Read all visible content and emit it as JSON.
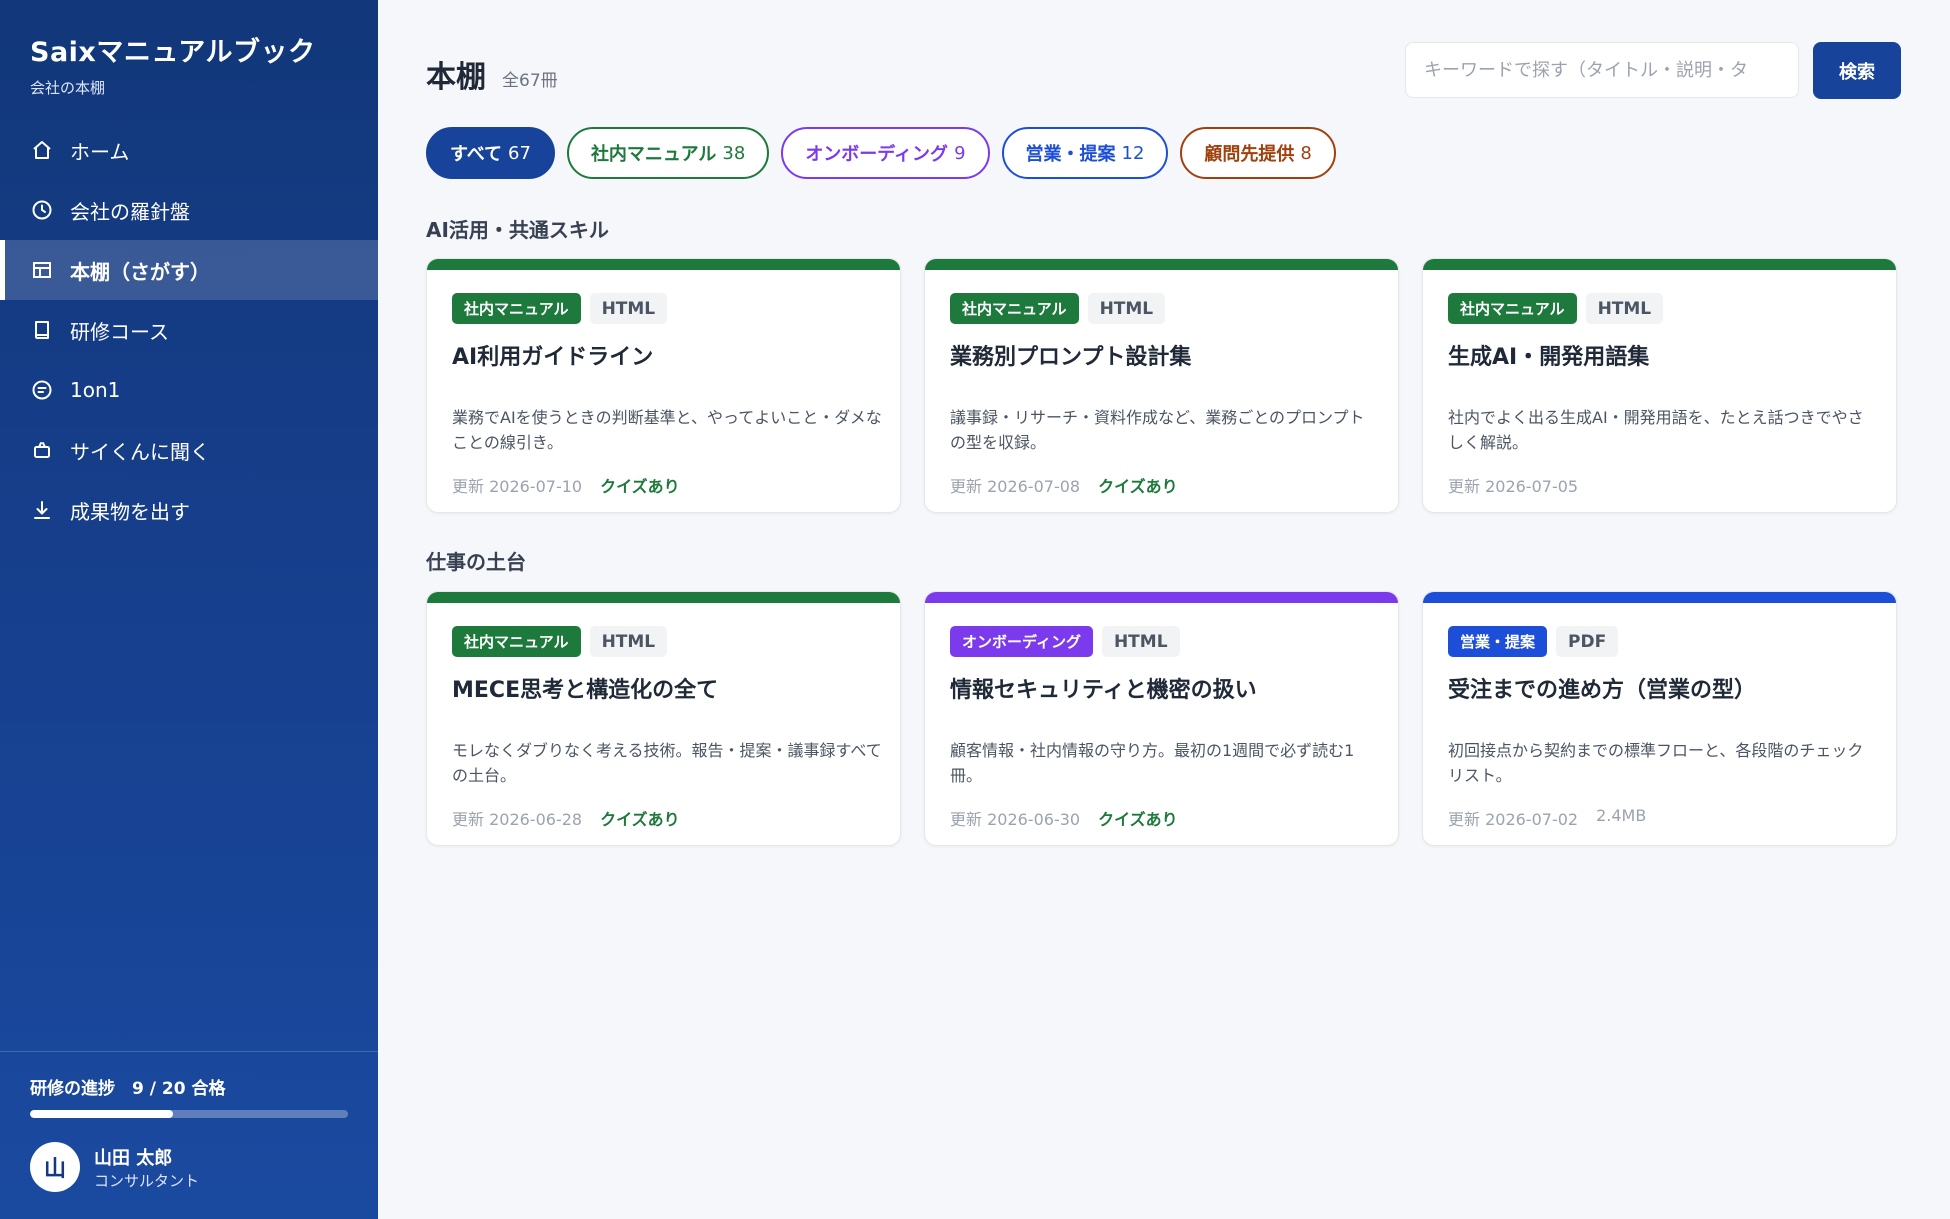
{
  "brand": {
    "title": "Saixマニュアルブック",
    "subtitle": "会社の本棚"
  },
  "nav": [
    {
      "label": "ホーム",
      "icon": "home-icon",
      "active": false
    },
    {
      "label": "会社の羅針盤",
      "icon": "compass-icon",
      "active": false
    },
    {
      "label": "本棚（さがす）",
      "icon": "bookshelf-icon",
      "active": true
    },
    {
      "label": "研修コース",
      "icon": "book-icon",
      "active": false
    },
    {
      "label": "1on1",
      "icon": "chat-icon",
      "active": false
    },
    {
      "label": "サイくんに聞く",
      "icon": "bot-icon",
      "active": false
    },
    {
      "label": "成果物を出す",
      "icon": "download-icon",
      "active": false
    }
  ],
  "progress": {
    "label": "研修の進捗　9 / 20 合格",
    "passed": 9,
    "total": 20
  },
  "user": {
    "initial": "山",
    "name": "山田 太郎",
    "role": "コンサルタント"
  },
  "header": {
    "title": "本棚",
    "count": "全67冊",
    "search_placeholder": "キーワードで探す（タイトル・説明・タ",
    "search_button": "検索"
  },
  "filters": [
    {
      "label": "すべて",
      "count": "67",
      "style": "all"
    },
    {
      "label": "社内マニュアル",
      "count": "38",
      "style": "green"
    },
    {
      "label": "オンボーディング",
      "count": "9",
      "style": "purple"
    },
    {
      "label": "営業・提案",
      "count": "12",
      "style": "blue"
    },
    {
      "label": "顧問先提供",
      "count": "8",
      "style": "brown"
    }
  ],
  "colors": {
    "green": "#1e7a3c",
    "purple": "#7c3aed",
    "blue": "#1d4ed8",
    "brown": "#a0410d"
  },
  "sections": [
    {
      "title": "AI活用・共通スキル",
      "cards": [
        {
          "category": "社内マニュアル",
          "color": "green",
          "format": "HTML",
          "title": "AI利用ガイドライン",
          "desc": "業務でAIを使うときの判断基準と、やってよいこと・ダメなことの線引き。",
          "updated": "更新 2026-07-10",
          "extra": "クイズあり",
          "extra_type": "quiz"
        },
        {
          "category": "社内マニュアル",
          "color": "green",
          "format": "HTML",
          "title": "業務別プロンプト設計集",
          "desc": "議事録・リサーチ・資料作成など、業務ごとのプロンプトの型を収録。",
          "updated": "更新 2026-07-08",
          "extra": "クイズあり",
          "extra_type": "quiz"
        },
        {
          "category": "社内マニュアル",
          "color": "green",
          "format": "HTML",
          "title": "生成AI・開発用語集",
          "desc": "社内でよく出る生成AI・開発用語を、たとえ話つきでやさしく解説。",
          "updated": "更新 2026-07-05",
          "extra": "",
          "extra_type": "none"
        }
      ]
    },
    {
      "title": "仕事の土台",
      "cards": [
        {
          "category": "社内マニュアル",
          "color": "green",
          "format": "HTML",
          "title": "MECE思考と構造化の全て",
          "desc": "モレなくダブりなく考える技術。報告・提案・議事録すべての土台。",
          "updated": "更新 2026-06-28",
          "extra": "クイズあり",
          "extra_type": "quiz"
        },
        {
          "category": "オンボーディング",
          "color": "purple",
          "format": "HTML",
          "title": "情報セキュリティと機密の扱い",
          "desc": "顧客情報・社内情報の守り方。最初の1週間で必ず読む1冊。",
          "updated": "更新 2026-06-30",
          "extra": "クイズあり",
          "extra_type": "quiz"
        },
        {
          "category": "営業・提案",
          "color": "blue",
          "format": "PDF",
          "title": "受注までの進め方（営業の型）",
          "desc": "初回接点から契約までの標準フローと、各段階のチェックリスト。",
          "updated": "更新 2026-07-02",
          "extra": "2.4MB",
          "extra_type": "size"
        }
      ]
    }
  ]
}
